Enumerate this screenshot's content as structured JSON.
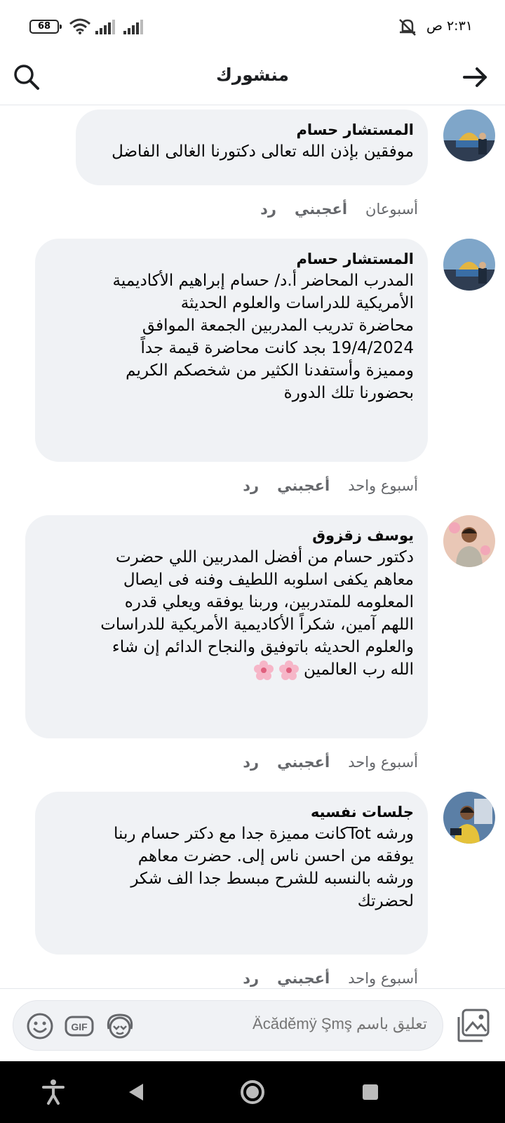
{
  "status_bar": {
    "battery": "68",
    "time": "٢:٣١ ص"
  },
  "header": {
    "title": "منشورك"
  },
  "comments": [
    {
      "author": "المستشار حسام",
      "text": "موفقين بإذن الله تعالى دكتورنا الغالى الفاضل",
      "time": "أسبوعان",
      "like_label": "أعجبني",
      "reply_label": "رد"
    },
    {
      "author": "المستشار حسام",
      "lines": [
        "المدرب المحاضر أ.د/ حسام إبراهيم الأكاديمية",
        "الأمريكية للدراسات والعلوم الحديثة",
        "محاضرة تدريب المدربين الجمعة الموافق",
        "19/4/2024 بجد كانت محاضرة قيمة جداً",
        "ومميزة وأستفدنا الكثير من شخصكم الكريم",
        "بحضورنا تلك الدورة"
      ],
      "time": "أسبوع واحد",
      "like_label": "أعجبني",
      "reply_label": "رد"
    },
    {
      "author": "يوسف زقزوق",
      "lines": [
        "دكتور حسام من أفضل المدربين اللي حضرت",
        "معاهم يكفى اسلوبه اللطيف وفنه فى ايصال",
        "المعلومه للمتدربين، وربنا يوفقه ويعلي قدره",
        "اللهم آمين، شكراً الأكاديمية الأمريكية للدراسات",
        "والعلوم الحديثه باتوفيق والنجاح الدائم إن شاء",
        "الله رب العالمين"
      ],
      "time": "أسبوع واحد",
      "like_label": "أعجبني",
      "reply_label": "رد"
    },
    {
      "author": "جلسات نفسيه",
      "lines": [
        "ورشه Totكانت مميزة جدا مع دكتر حسام ربنا",
        "يوفقه  من احسن ناس إلى. حضرت معاهم",
        "ورشه بالنسبه للشرح مبسط جدا الف شكر",
        "لحضرتك"
      ],
      "time": "أسبوع واحد",
      "like_label": "أعجبني",
      "reply_label": "رد"
    }
  ],
  "composer": {
    "placeholder": "تعليق باسم Äcădĕmÿ Şmş",
    "gif_label": "GIF"
  },
  "colors": {
    "bubble": "#f0f2f5",
    "meta": "#65676b",
    "text": "#050505",
    "nav_bar": "#000000"
  }
}
